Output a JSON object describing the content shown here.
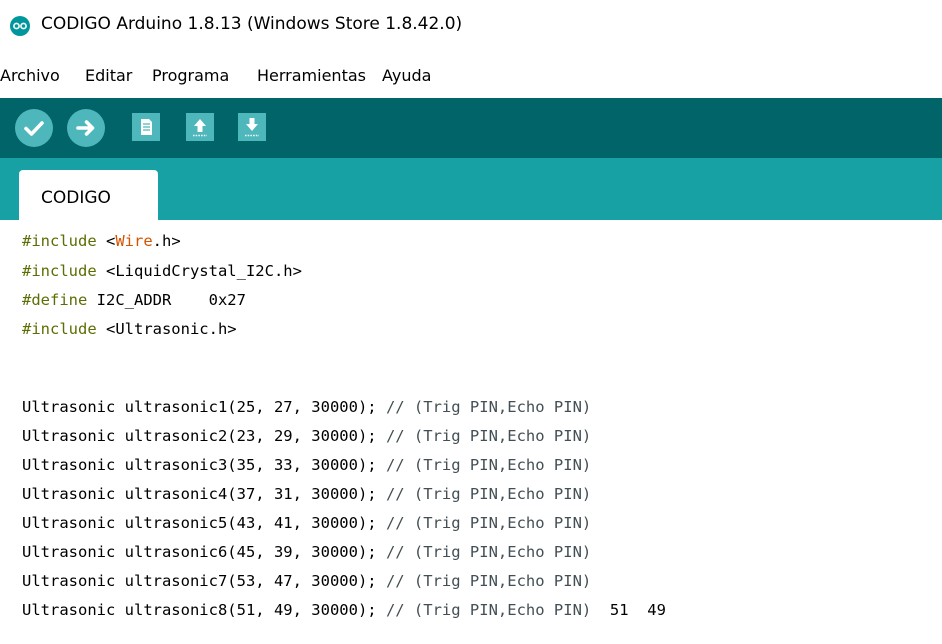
{
  "window": {
    "title": "CODIGO Arduino 1.8.13 (Windows Store 1.8.42.0)",
    "icon": "arduino-logo-icon",
    "accent": "#00979c"
  },
  "menu": {
    "items": [
      "Archivo",
      "Editar",
      "Programa",
      "Herramientas",
      "Ayuda"
    ]
  },
  "toolbar": {
    "buttons": [
      {
        "name": "verify-button",
        "icon": "check-icon"
      },
      {
        "name": "upload-button",
        "icon": "arrow-right-icon"
      },
      {
        "name": "new-button",
        "icon": "new-file-icon"
      },
      {
        "name": "open-button",
        "icon": "arrow-up-icon"
      },
      {
        "name": "save-button",
        "icon": "arrow-down-icon"
      }
    ],
    "bg": "#006468",
    "button_color": "#4db7bb"
  },
  "tabs": {
    "active": "CODIGO",
    "strip_color": "#17a1a5"
  },
  "editor": {
    "lines": [
      {
        "pre": "#include",
        "rest": " <",
        "lib": "Wire",
        "tail": ".h>"
      },
      {
        "pre": "#include",
        "rest": " <LiquidCrystal_I2C.h>",
        "lib": "",
        "tail": ""
      },
      {
        "pre": "#define",
        "rest": " I2C_ADDR    0x27",
        "lib": "",
        "tail": ""
      },
      {
        "pre": "#include",
        "rest": " <Ultrasonic.h>",
        "lib": "",
        "tail": ""
      },
      {
        "code": "Ultrasonic ultrasonic1(25, 27, 30000);",
        "comment": " // (Trig PIN,Echo PIN)"
      },
      {
        "code": "Ultrasonic ultrasonic2(23, 29, 30000);",
        "comment": " // (Trig PIN,Echo PIN)"
      },
      {
        "code": "Ultrasonic ultrasonic3(35, 33, 30000);",
        "comment": " // (Trig PIN,Echo PIN)"
      },
      {
        "code": "Ultrasonic ultrasonic4(37, 31, 30000);",
        "comment": " // (Trig PIN,Echo PIN)"
      },
      {
        "code": "Ultrasonic ultrasonic5(43, 41, 30000);",
        "comment": " // (Trig PIN,Echo PIN)"
      },
      {
        "code": "Ultrasonic ultrasonic6(45, 39, 30000);",
        "comment": " // (Trig PIN,Echo PIN)"
      },
      {
        "code": "Ultrasonic ultrasonic7(53, 47, 30000);",
        "comment": " // (Trig PIN,Echo PIN)"
      },
      {
        "code": "Ultrasonic ultrasonic8(51, 49, 30000);",
        "comment": " // (Trig PIN,Echo PIN)",
        "ghost": "  51  49"
      }
    ]
  }
}
